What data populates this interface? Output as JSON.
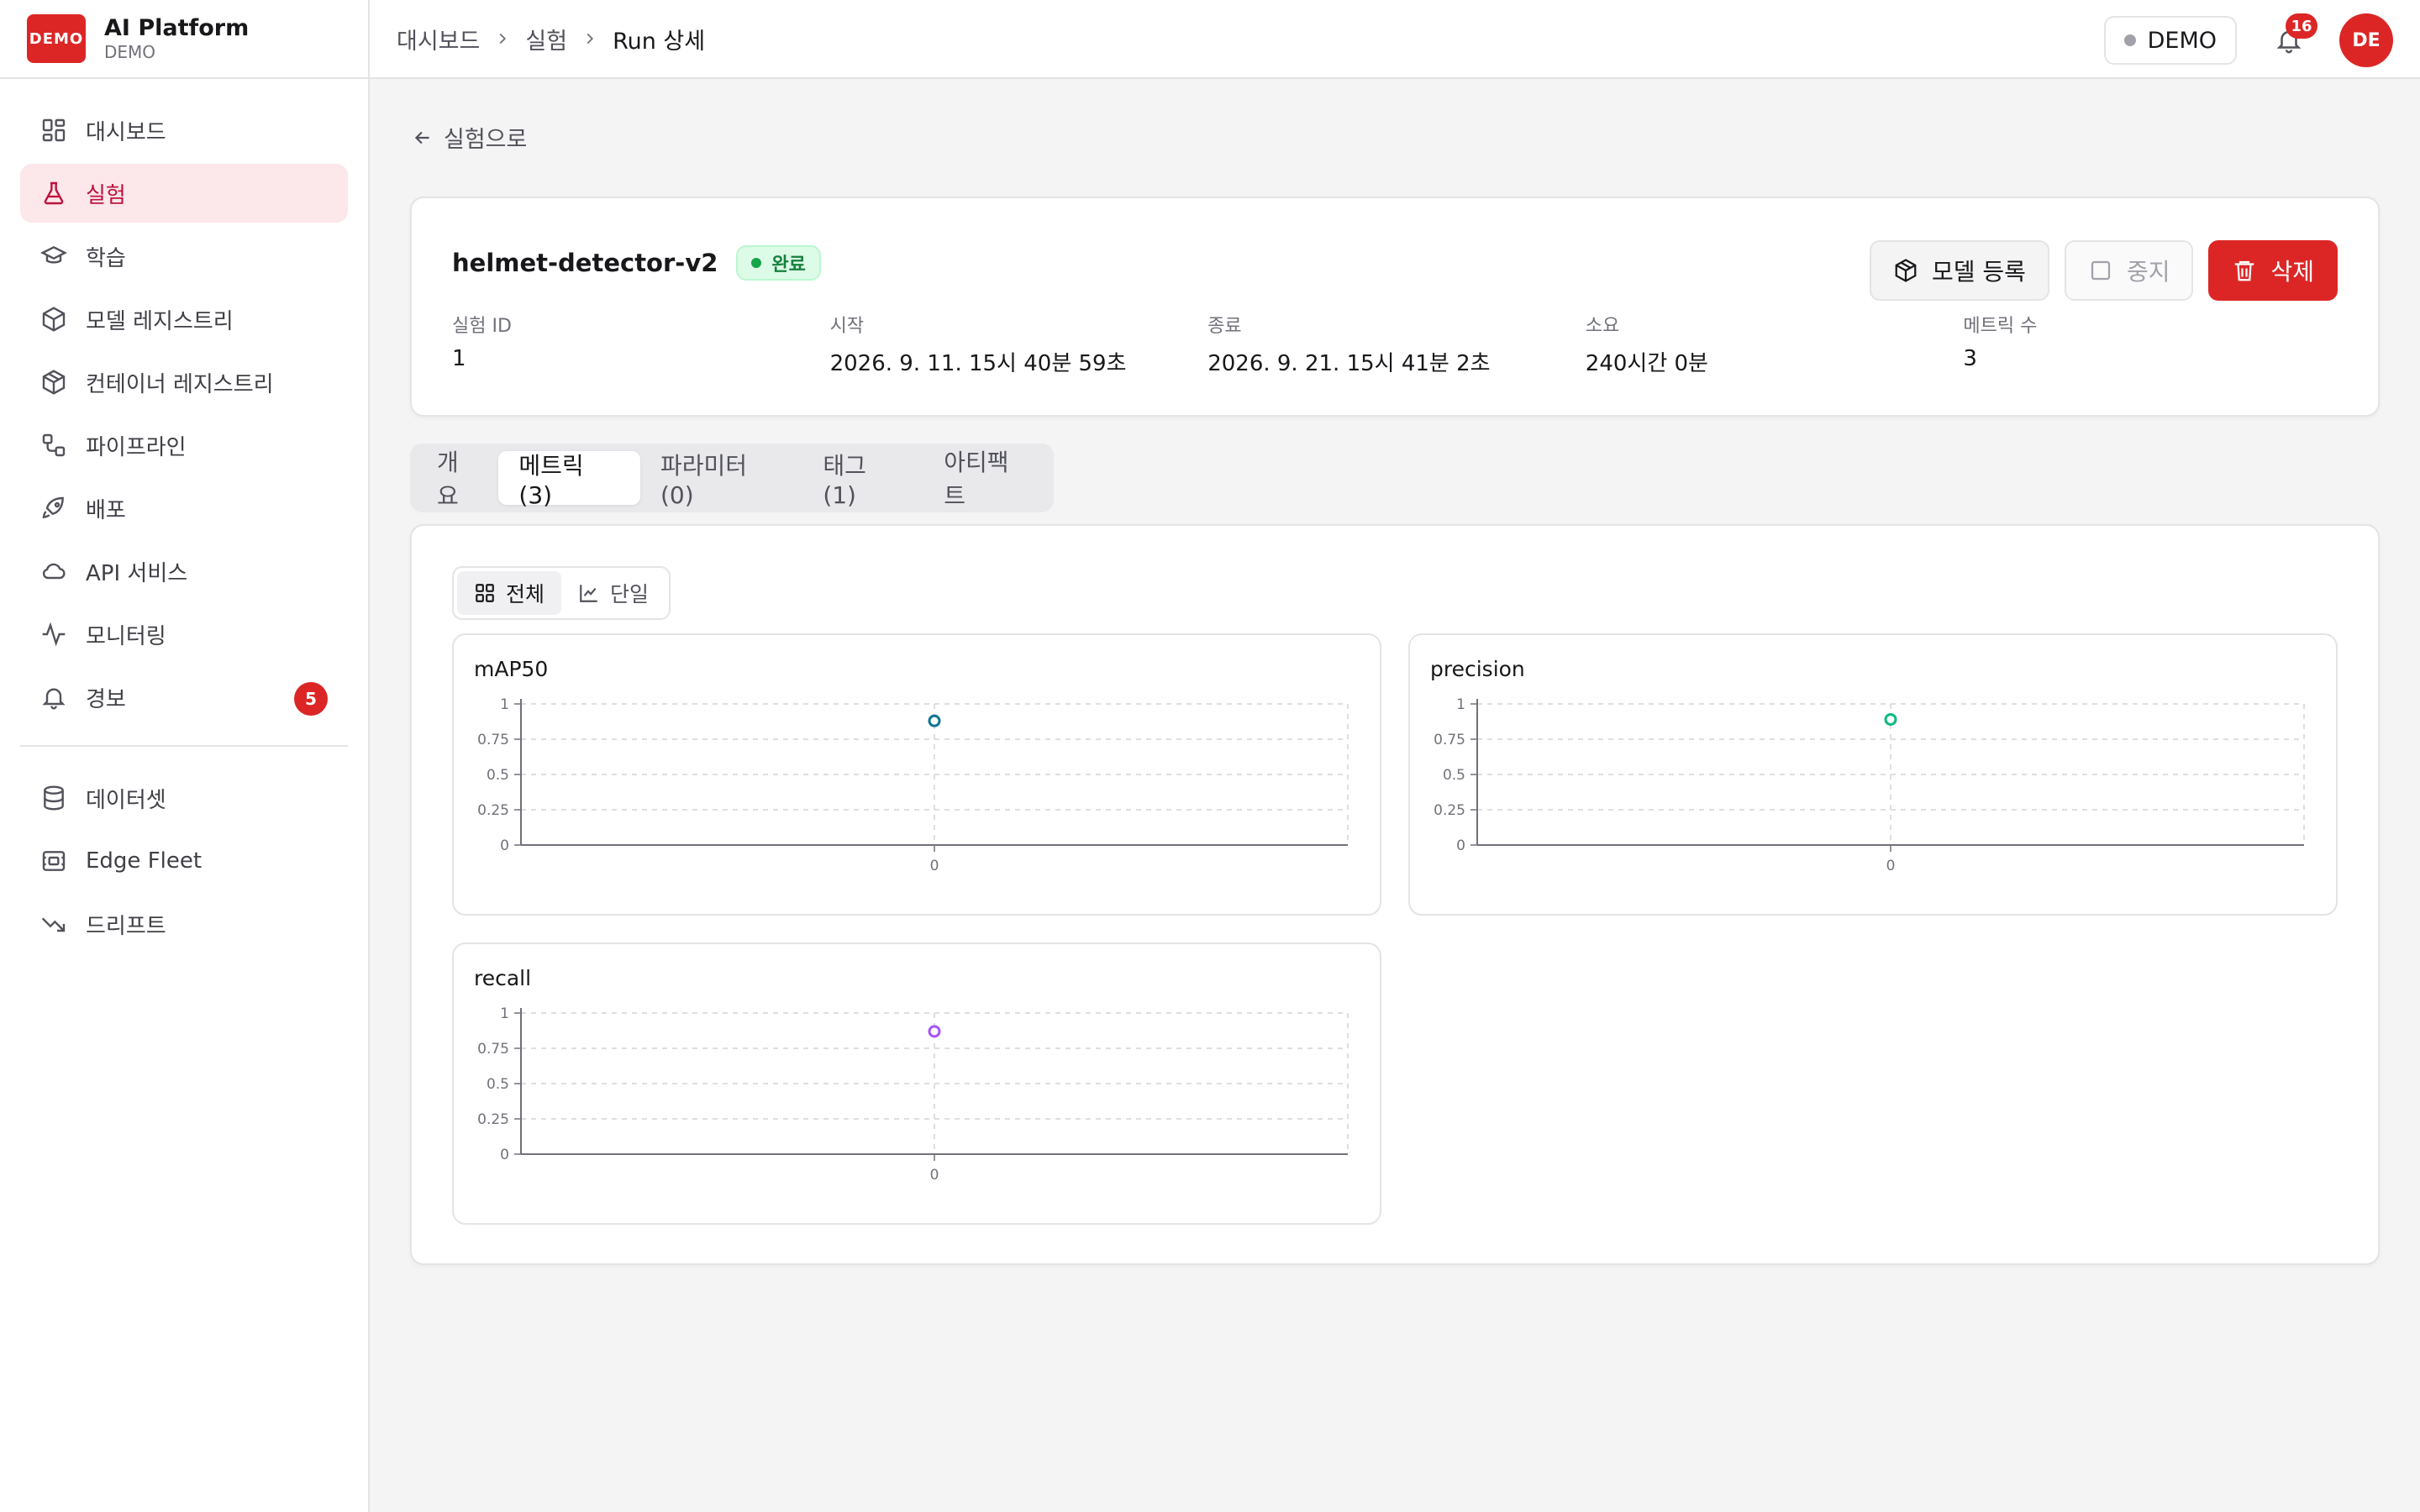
{
  "brand": {
    "logo_text": "DEMO",
    "title": "AI Platform",
    "subtitle": "DEMO"
  },
  "sidebar": {
    "items": [
      {
        "label": "대시보드",
        "icon": "dashboard-icon"
      },
      {
        "label": "실험",
        "icon": "flask-icon"
      },
      {
        "label": "학습",
        "icon": "graduation-cap-icon"
      },
      {
        "label": "모델 레지스트리",
        "icon": "box-icon"
      },
      {
        "label": "컨테이너 레지스트리",
        "icon": "container-icon"
      },
      {
        "label": "파이프라인",
        "icon": "workflow-icon"
      },
      {
        "label": "배포",
        "icon": "rocket-icon"
      },
      {
        "label": "API 서비스",
        "icon": "cloud-icon"
      },
      {
        "label": "모니터링",
        "icon": "activity-icon"
      },
      {
        "label": "경보",
        "icon": "bell-icon",
        "badge": "5"
      }
    ],
    "secondary_items": [
      {
        "label": "데이터셋",
        "icon": "database-icon"
      },
      {
        "label": "Edge Fleet",
        "icon": "edge-device-icon"
      },
      {
        "label": "드리프트",
        "icon": "trending-down-icon"
      }
    ]
  },
  "header": {
    "breadcrumb": [
      "대시보드",
      "실험",
      "Run 상세"
    ],
    "org_label": "DEMO",
    "notification_count": "16",
    "avatar_initials": "DE"
  },
  "main": {
    "back_label": "실험으로",
    "run": {
      "name": "helmet-detector-v2",
      "status": "완료",
      "actions": {
        "register": "모델 등록",
        "stop": "중지",
        "delete": "삭제"
      },
      "meta": [
        {
          "label": "실험 ID",
          "value": "1"
        },
        {
          "label": "시작",
          "value": "2026. 9. 11. 15시 40분 59초"
        },
        {
          "label": "종료",
          "value": "2026. 9. 21. 15시 41분 2초"
        },
        {
          "label": "소요",
          "value": "240시간 0분"
        },
        {
          "label": "메트릭 수",
          "value": "3"
        }
      ]
    },
    "tabs": [
      "개요",
      "메트릭 (3)",
      "파라미터 (0)",
      "태그 (1)",
      "아티팩트"
    ],
    "view_toggle": {
      "all": "전체",
      "single": "단일"
    }
  },
  "colors": {
    "accent": "#dc2626",
    "mAP50": "#0e7490",
    "precision": "#10b981",
    "recall": "#a855f7"
  },
  "chart_data": [
    {
      "type": "line",
      "title": "mAP50",
      "x": [
        0
      ],
      "series": [
        {
          "values": [
            0.88
          ]
        }
      ],
      "ylim": [
        0,
        1
      ],
      "yticks": [
        "0",
        "0.25",
        "0.5",
        "0.75",
        "1"
      ],
      "xticks": [
        "0"
      ],
      "grid": true
    },
    {
      "type": "line",
      "title": "precision",
      "x": [
        0
      ],
      "series": [
        {
          "values": [
            0.89
          ]
        }
      ],
      "ylim": [
        0,
        1
      ],
      "yticks": [
        "0",
        "0.25",
        "0.5",
        "0.75",
        "1"
      ],
      "xticks": [
        "0"
      ],
      "grid": true
    },
    {
      "type": "line",
      "title": "recall",
      "x": [
        0
      ],
      "series": [
        {
          "values": [
            0.87
          ]
        }
      ],
      "ylim": [
        0,
        1
      ],
      "yticks": [
        "0",
        "0.25",
        "0.5",
        "0.75",
        "1"
      ],
      "xticks": [
        "0"
      ],
      "grid": true
    }
  ]
}
